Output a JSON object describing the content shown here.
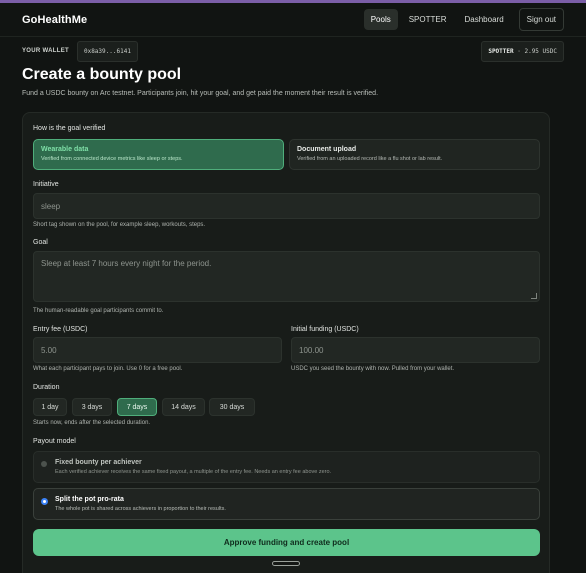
{
  "nav": {
    "brand": "GoHealthMe",
    "links": [
      "Pools",
      "SPOTTER",
      "Dashboard",
      "Sign out"
    ]
  },
  "wallet": {
    "label": "YOUR WALLET",
    "address": "0x8a39...6141",
    "balance_name": "SPOTTER",
    "balance_value": "· 2.95 USDC"
  },
  "page": {
    "title": "Create a bounty pool",
    "subtitle": "Fund a USDC bounty on Arc testnet. Participants join, hit your goal, and get paid the moment their result is verified."
  },
  "verification": {
    "label": "How is the goal verified",
    "options": [
      {
        "title": "Wearable data",
        "desc": "Verified from connected device metrics like sleep or steps."
      },
      {
        "title": "Document upload",
        "desc": "Verified from an uploaded record like a flu shot or lab result."
      }
    ],
    "selected": "Wearable data"
  },
  "initiative": {
    "label": "Initiative",
    "placeholder": "sleep",
    "hint": "Short tag shown on the pool, for example sleep, workouts, steps."
  },
  "goal": {
    "label": "Goal",
    "placeholder": "Sleep at least 7 hours every night for the period.",
    "hint": "The human-readable goal participants commit to."
  },
  "entry_fee": {
    "label": "Entry fee (USDC)",
    "placeholder": "5.00",
    "hint": "What each participant pays to join. Use 0 for a free pool."
  },
  "initial_funding": {
    "label": "Initial funding (USDC)",
    "placeholder": "100.00",
    "hint": "USDC you seed the bounty with now. Pulled from your wallet."
  },
  "duration": {
    "label": "Duration",
    "options": [
      "1 day",
      "3 days",
      "7 days",
      "14 days",
      "30 days"
    ],
    "selected": "7 days",
    "hint": "Starts now, ends after the selected duration."
  },
  "payout": {
    "label": "Payout model",
    "options": [
      {
        "title": "Fixed bounty per achiever",
        "desc": "Each verified achiever receives the same fixed payout, a multiple of the entry fee. Needs an entry fee above zero."
      },
      {
        "title": "Split the pot pro-rata",
        "desc": "The whole pot is shared across achievers in proportion to their results."
      }
    ],
    "selected": "Split the pot pro-rata"
  },
  "submit_label": "Approve funding and create pool",
  "colors": {
    "accent": "#5cc48b",
    "selected_bg": "#2f6b4d",
    "background": "#111412"
  }
}
